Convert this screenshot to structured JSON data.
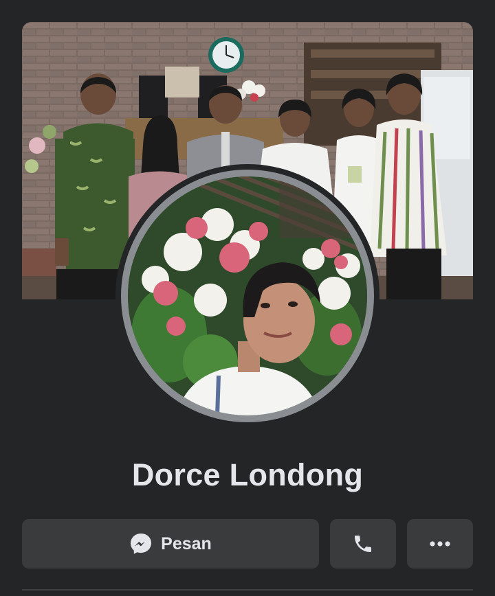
{
  "profile": {
    "name": "Dorce Londong"
  },
  "actions": {
    "message_label": "Pesan",
    "message_icon": "messenger-icon",
    "call_icon": "phone-icon",
    "more_icon": "more-icon"
  },
  "colors": {
    "background": "#242526",
    "button": "#3a3b3c",
    "text": "#e4e6eb",
    "avatar_border": "#8a8d91"
  }
}
